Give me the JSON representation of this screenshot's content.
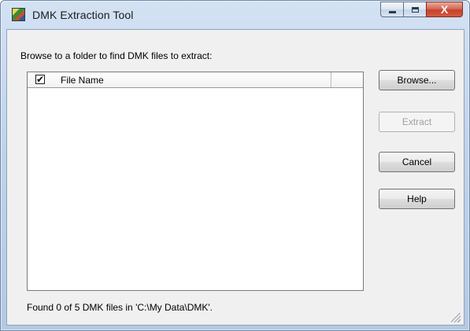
{
  "window": {
    "title": "DMK Extraction Tool",
    "icon": "dmk-app-icon",
    "controls": {
      "minimize": "minimize-icon",
      "maximize": "maximize-icon",
      "close_glyph": "X"
    }
  },
  "instruction": "Browse to a folder to find DMK files to extract:",
  "file_list": {
    "header_checked": true,
    "header_check_glyph": "✔",
    "columns": [
      "File Name",
      ""
    ],
    "rows": []
  },
  "buttons": {
    "browse": "Browse...",
    "extract": "Extract",
    "cancel": "Cancel",
    "help": "Help"
  },
  "button_states": {
    "extract_enabled": false
  },
  "status": "Found 0 of 5 DMK files in 'C:\\My Data\\DMK'.",
  "colors": {
    "title_bar": "#c7d8ee",
    "client_bg": "#f0f0f0",
    "close_button": "#c4422c"
  }
}
